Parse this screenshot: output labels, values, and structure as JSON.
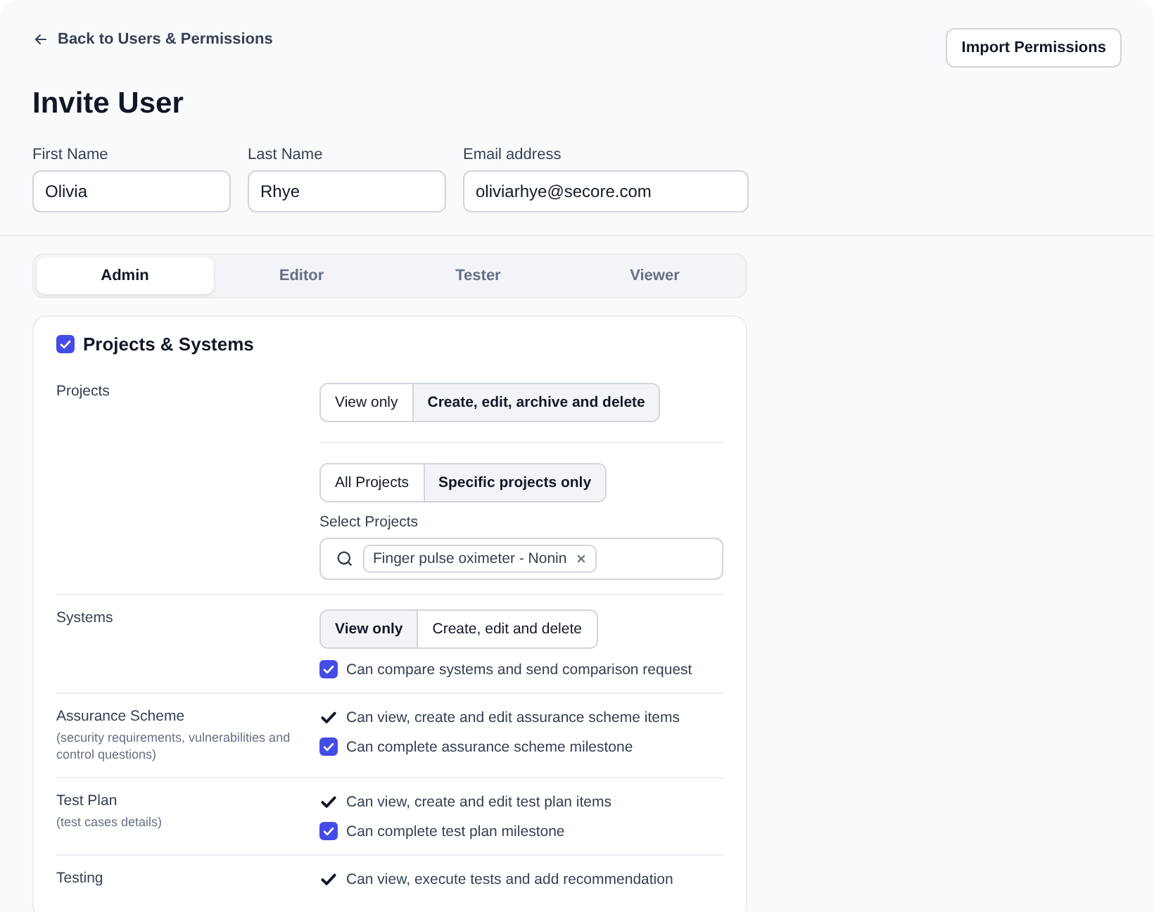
{
  "back_link": {
    "label": "Back to Users & Permissions"
  },
  "import_button": {
    "label": "Import Permissions"
  },
  "title": "Invite User",
  "fields": [
    {
      "label": "First Name",
      "value": "Olivia"
    },
    {
      "label": "Last Name",
      "value": "Rhye"
    },
    {
      "label": "Email address",
      "value": "oliviarhye@secore.com"
    }
  ],
  "tabs": [
    {
      "label": "Admin",
      "selected": true
    },
    {
      "label": "Editor",
      "selected": false
    },
    {
      "label": "Tester",
      "selected": false
    },
    {
      "label": "Viewer",
      "selected": false
    }
  ],
  "section": {
    "title": "Projects & Systems",
    "checked": true,
    "rows": [
      {
        "label": "Projects",
        "controls": [
          {
            "kind": "segmented",
            "options": [
              {
                "label": "View only",
                "selected": false
              },
              {
                "label": "Create, edit, archive and delete",
                "selected": true
              }
            ]
          },
          {
            "kind": "rule"
          },
          {
            "kind": "segmented",
            "options": [
              {
                "label": "All Projects",
                "selected": false
              },
              {
                "label": "Specific projects only",
                "selected": true
              }
            ]
          },
          {
            "kind": "picker",
            "label": "Select Projects",
            "tags": [
              "Finger pulse oximeter - Nonin"
            ]
          }
        ]
      },
      {
        "label": "Systems",
        "controls": [
          {
            "kind": "segmented",
            "options": [
              {
                "label": "View only",
                "selected": true
              },
              {
                "label": "Create, edit and delete",
                "selected": false
              }
            ]
          },
          {
            "kind": "checkbox",
            "text": "Can compare systems and send comparison request",
            "checked": true
          }
        ]
      },
      {
        "label": "Assurance Scheme",
        "note": "(security requirements, vulnerabilities and control questions)",
        "controls": [
          {
            "kind": "check",
            "text": "Can view, create and edit assurance scheme items"
          },
          {
            "kind": "checkbox",
            "text": "Can complete assurance scheme milestone",
            "checked": true
          }
        ]
      },
      {
        "label": "Test Plan",
        "note": "(test cases details)",
        "controls": [
          {
            "kind": "check",
            "text": "Can view, create and edit test plan items"
          },
          {
            "kind": "checkbox",
            "text": "Can complete test plan milestone",
            "checked": true
          }
        ]
      },
      {
        "label": "Testing",
        "controls": [
          {
            "kind": "check",
            "text": "Can view, execute tests and add recommendation"
          }
        ]
      }
    ]
  }
}
